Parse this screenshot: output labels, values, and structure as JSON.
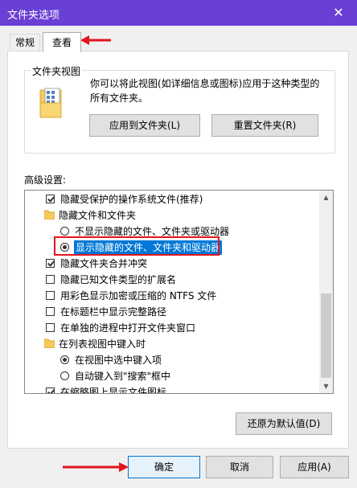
{
  "window": {
    "title": "文件夹选项",
    "close_glyph": "✕"
  },
  "tabs": [
    {
      "label": "常规",
      "active": false
    },
    {
      "label": "查看",
      "active": true
    }
  ],
  "folder_views": {
    "group_title": "文件夹视图",
    "description": "你可以将此视图(如详细信息或图标)应用于这种类型的所有文件夹。",
    "apply_button": "应用到文件夹(L)",
    "reset_button": "重置文件夹(R)"
  },
  "advanced": {
    "label": "高级设置:",
    "items": [
      {
        "kind": "checkbox",
        "checked": true,
        "label": "隐藏受保护的操作系统文件(推荐)"
      },
      {
        "kind": "folder",
        "label": "隐藏文件和文件夹"
      },
      {
        "kind": "radio",
        "checked": false,
        "label": "不显示隐藏的文件、文件夹或驱动器"
      },
      {
        "kind": "radio",
        "checked": true,
        "label": "显示隐藏的文件、文件夹和驱动器",
        "selected": true
      },
      {
        "kind": "checkbox",
        "checked": true,
        "label": "隐藏文件夹合并冲突"
      },
      {
        "kind": "checkbox",
        "checked": false,
        "label": "隐藏已知文件类型的扩展名"
      },
      {
        "kind": "checkbox",
        "checked": false,
        "label": "用彩色显示加密或压缩的 NTFS 文件"
      },
      {
        "kind": "checkbox",
        "checked": false,
        "label": "在标题栏中显示完整路径"
      },
      {
        "kind": "checkbox",
        "checked": false,
        "label": "在单独的进程中打开文件夹窗口"
      },
      {
        "kind": "folder",
        "label": "在列表视图中键入时"
      },
      {
        "kind": "radio",
        "checked": true,
        "label": "在视图中选中键入项"
      },
      {
        "kind": "radio",
        "checked": false,
        "label": "自动键入到\"搜索\"框中"
      },
      {
        "kind": "checkbox",
        "checked": true,
        "label": "在缩略图上显示文件图标"
      }
    ],
    "restore_button": "还原为默认值(D)"
  },
  "footer": {
    "ok_button": "确定",
    "cancel_button": "取消",
    "apply_button": "应用(A)"
  },
  "colors": {
    "titlebar": "#6a3fd4",
    "annotation": "#e3141c",
    "selection": "#0078d7"
  }
}
